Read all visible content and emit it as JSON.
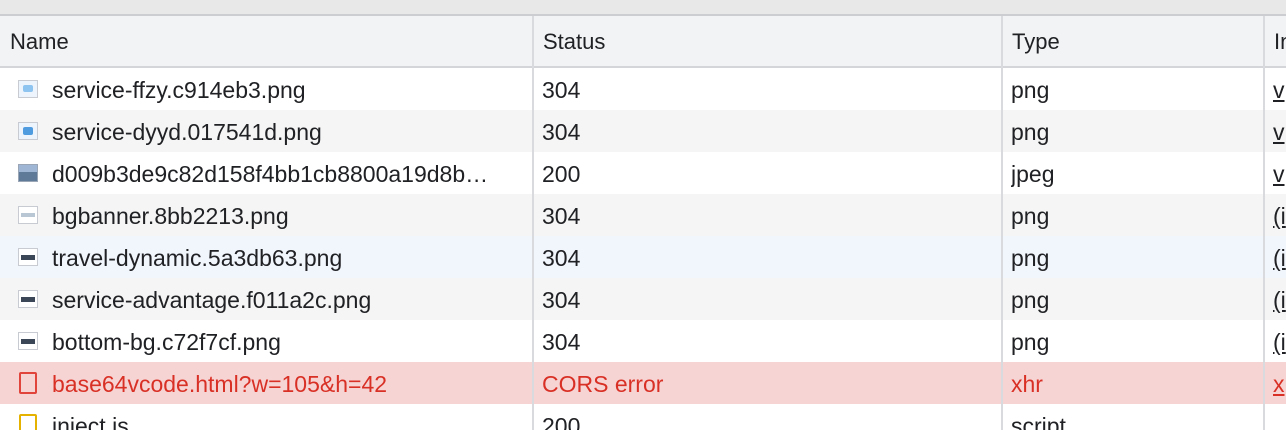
{
  "columns": {
    "name": "Name",
    "status": "Status",
    "type": "Type",
    "initiator": "In"
  },
  "rows": [
    {
      "name": "service-ffzy.c914eb3.png",
      "status": "304",
      "type": "png",
      "initiator": "v",
      "icon": "image-icon"
    },
    {
      "name": "service-dyyd.017541d.png",
      "status": "304",
      "type": "png",
      "initiator": "v",
      "icon": "image-icon"
    },
    {
      "name": "d009b3de9c82d158f4bb1cb8800a19d8b…",
      "status": "200",
      "type": "jpeg",
      "initiator": "v",
      "icon": "photo-icon"
    },
    {
      "name": "bgbanner.8bb2213.png",
      "status": "304",
      "type": "png",
      "initiator": "(i",
      "icon": "image-icon"
    },
    {
      "name": "travel-dynamic.5a3db63.png",
      "status": "304",
      "type": "png",
      "initiator": "(i",
      "icon": "image-icon"
    },
    {
      "name": "service-advantage.f011a2c.png",
      "status": "304",
      "type": "png",
      "initiator": "(i",
      "icon": "image-icon"
    },
    {
      "name": "bottom-bg.c72f7cf.png",
      "status": "304",
      "type": "png",
      "initiator": "(i",
      "icon": "image-icon"
    },
    {
      "name": "base64vcode.html?w=105&h=42",
      "status": "CORS error",
      "type": "xhr",
      "initiator": "x",
      "icon": "document-icon"
    },
    {
      "name": "inject.js",
      "status": "200",
      "type": "script",
      "initiator": "",
      "icon": "script-icon"
    }
  ],
  "colors": {
    "error_text": "#d93025",
    "error_row": "#f6d4d4",
    "header_bg": "#f1f3f4"
  }
}
